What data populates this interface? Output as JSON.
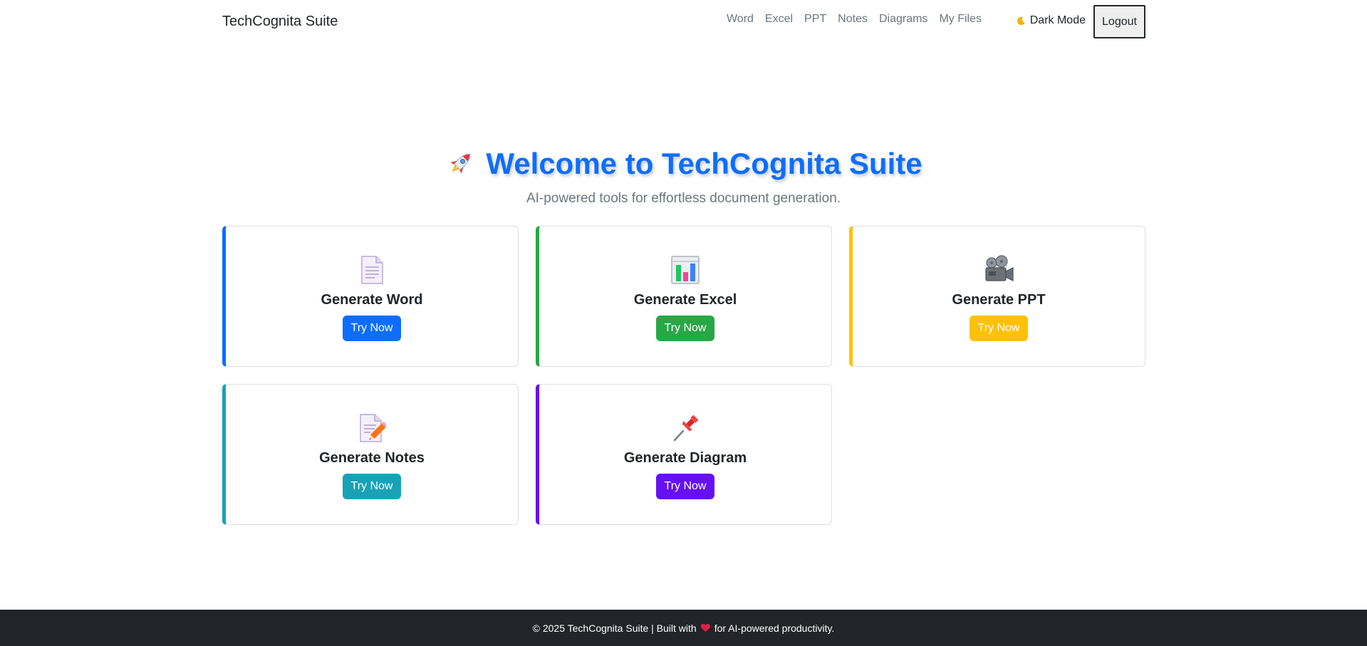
{
  "navbar": {
    "brand": "TechCognita Suite",
    "links": [
      "Word",
      "Excel",
      "PPT",
      "Notes",
      "Diagrams",
      "My Files"
    ],
    "dark_mode_label": "Dark Mode",
    "dark_mode_icon": "moon-icon",
    "logout_label": "Logout"
  },
  "hero": {
    "icon": "rocket-icon",
    "title": "Welcome to TechCognita Suite",
    "subtitle": "AI-powered tools for effortless document generation."
  },
  "cards": [
    {
      "title": "Generate Word",
      "button": "Try Now",
      "icon": "document-icon",
      "accent": "#0d6efd"
    },
    {
      "title": "Generate Excel",
      "button": "Try Now",
      "icon": "bar-chart-icon",
      "accent": "#28a745"
    },
    {
      "title": "Generate PPT",
      "button": "Try Now",
      "icon": "movie-camera-icon",
      "accent": "#ffc107"
    },
    {
      "title": "Generate Notes",
      "button": "Try Now",
      "icon": "memo-icon",
      "accent": "#17a2b8"
    },
    {
      "title": "Generate Diagram",
      "button": "Try Now",
      "icon": "pushpin-icon",
      "accent": "#6610f2"
    }
  ],
  "footer": {
    "before": "© 2025 TechCognita Suite | Built with",
    "icon": "heart-icon",
    "after": "for AI-powered productivity."
  }
}
